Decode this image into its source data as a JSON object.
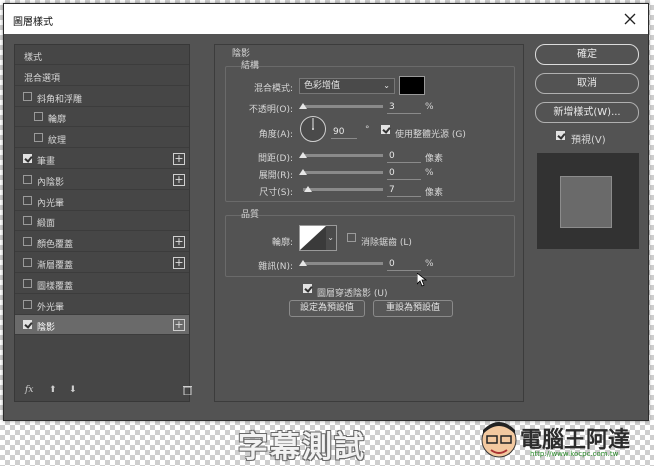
{
  "window": {
    "title": "圖層樣式"
  },
  "sidebar": {
    "items": [
      {
        "label": "樣式",
        "checkbox": false,
        "checked": false,
        "plus": false,
        "indent": "plain",
        "active": false
      },
      {
        "label": "混合選項",
        "checkbox": false,
        "checked": false,
        "plus": false,
        "indent": "plain",
        "active": false
      },
      {
        "label": "斜角和浮雕",
        "checkbox": true,
        "checked": false,
        "plus": false,
        "indent": "top",
        "active": false
      },
      {
        "label": "輪廓",
        "checkbox": true,
        "checked": false,
        "plus": false,
        "indent": "sub",
        "active": false
      },
      {
        "label": "紋理",
        "checkbox": true,
        "checked": false,
        "plus": false,
        "indent": "sub",
        "active": false
      },
      {
        "label": "筆畫",
        "checkbox": true,
        "checked": true,
        "plus": true,
        "indent": "top",
        "active": false
      },
      {
        "label": "內陰影",
        "checkbox": true,
        "checked": false,
        "plus": true,
        "indent": "top",
        "active": false
      },
      {
        "label": "內光暈",
        "checkbox": true,
        "checked": false,
        "plus": false,
        "indent": "top",
        "active": false
      },
      {
        "label": "緞面",
        "checkbox": true,
        "checked": false,
        "plus": false,
        "indent": "top",
        "active": false
      },
      {
        "label": "顏色覆蓋",
        "checkbox": true,
        "checked": false,
        "plus": true,
        "indent": "top",
        "active": false
      },
      {
        "label": "漸層覆蓋",
        "checkbox": true,
        "checked": false,
        "plus": true,
        "indent": "top",
        "active": false
      },
      {
        "label": "圖樣覆蓋",
        "checkbox": true,
        "checked": false,
        "plus": false,
        "indent": "top",
        "active": false
      },
      {
        "label": "外光暈",
        "checkbox": true,
        "checked": false,
        "plus": false,
        "indent": "top",
        "active": false
      },
      {
        "label": "陰影",
        "checkbox": true,
        "checked": true,
        "plus": true,
        "indent": "top",
        "active": true
      }
    ],
    "footer": {
      "fx": "fx"
    }
  },
  "shadow": {
    "title": "陰影",
    "structure_title": "結構",
    "blend_mode_label": "混合模式:",
    "blend_mode_value": "色彩增值",
    "shadow_color": "#000000",
    "opacity_label": "不透明(O):",
    "opacity_value": "3",
    "opacity_unit": "%",
    "angle_label": "角度(A):",
    "angle_value": "90",
    "angle_unit": "°",
    "global_light_label": "使用整體光源 (G)",
    "global_light_checked": true,
    "distance_label": "間距(D):",
    "distance_value": "0",
    "distance_unit": "像素",
    "spread_label": "展開(R):",
    "spread_value": "0",
    "spread_unit": "%",
    "size_label": "尺寸(S):",
    "size_value": "7",
    "size_unit": "像素",
    "quality_title": "品質",
    "contour_label": "輪廓:",
    "antialias_label": "消除鋸齒 (L)",
    "antialias_checked": false,
    "noise_label": "雜訊(N):",
    "noise_value": "0",
    "noise_unit": "%",
    "knockout_label": "圖層穿透陰影 (U)",
    "knockout_checked": true,
    "make_default_label": "設定為預設值",
    "reset_default_label": "重設為預設值"
  },
  "actions": {
    "ok_label": "確定",
    "cancel_label": "取消",
    "new_style_label": "新增樣式(W)...",
    "preview_label": "預視(V)",
    "preview_checked": true
  },
  "overlay": {
    "caption": "字幕測試",
    "brand": "電腦王阿達",
    "brand_url": "http://www.kocpc.com.tw"
  }
}
